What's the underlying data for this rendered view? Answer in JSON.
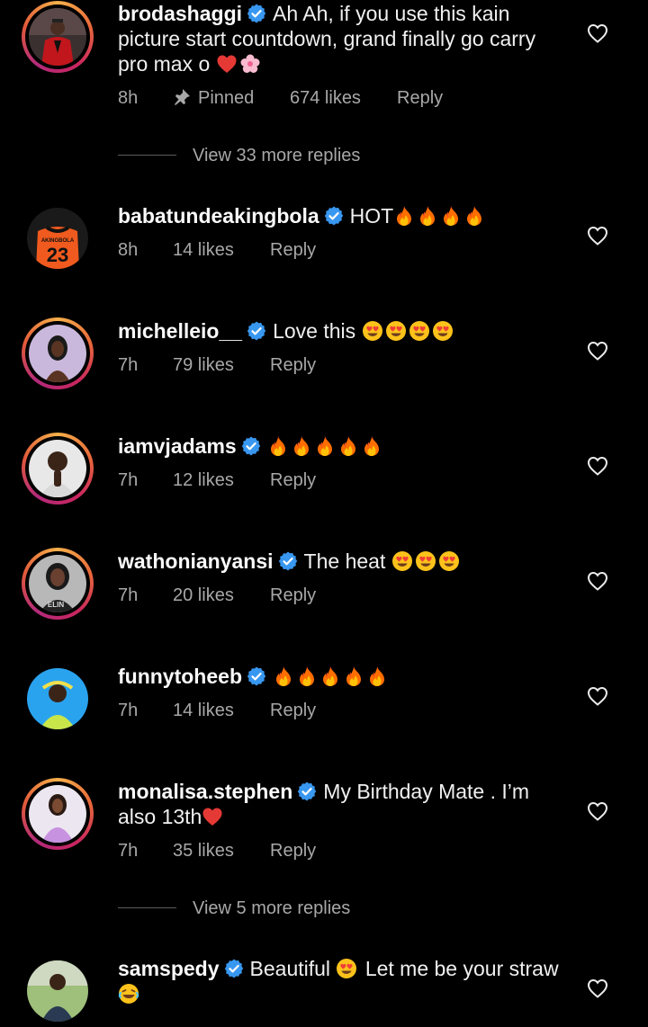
{
  "comments": [
    {
      "username": "brodashaggi",
      "text": "Ah Ah, if you use this kain picture start countdown, grand finally go carry pro max o",
      "time": "8h",
      "pinned_label": "Pinned",
      "likes": "674 likes",
      "reply": "Reply",
      "avatar": "red-suit-man"
    },
    {
      "username": "babatundeakingbola",
      "text": "HOT",
      "time": "8h",
      "likes": "14 likes",
      "reply": "Reply",
      "avatar": "jersey-23",
      "jersey_name": "AKINGBOLA",
      "jersey_number": "23"
    },
    {
      "username": "michelleio__",
      "text": "Love this",
      "time": "7h",
      "likes": "79 likes",
      "reply": "Reply",
      "avatar": "woman-lilac"
    },
    {
      "username": "iamvjadams",
      "text": "",
      "time": "7h",
      "likes": "12 likes",
      "reply": "Reply",
      "avatar": "man-praying"
    },
    {
      "username": "wathonianyansi",
      "text": "The heat",
      "time": "7h",
      "likes": "20 likes",
      "reply": "Reply",
      "avatar": "woman-elin",
      "shirt_text": "ELIN"
    },
    {
      "username": "funnytoheeb",
      "text": "",
      "time": "7h",
      "likes": "14 likes",
      "reply": "Reply",
      "avatar": "man-blue-bg"
    },
    {
      "username": "monalisa.stephen",
      "text": "My Birthday Mate . I’m also 13th",
      "time": "7h",
      "likes": "35 likes",
      "reply": "Reply",
      "avatar": "woman-purple"
    },
    {
      "username": "samspedy",
      "text_part1": "Beautiful",
      "text_part2": "Let me be your straw",
      "avatar": "man-outdoor"
    }
  ],
  "view_more": [
    {
      "label": "View 33 more replies"
    },
    {
      "label": "View 5 more replies"
    }
  ],
  "colors": {
    "background": "#000000",
    "meta_text": "#a8a8a8",
    "verified_blue": "#3897f0",
    "story_ring": [
      "#f6b04a",
      "#c9265f"
    ]
  },
  "icons": [
    "verified-badge-icon",
    "heart-outline-icon",
    "pin-icon",
    "fire-emoji",
    "heart-eyes-emoji",
    "red-heart-emoji",
    "blossom-emoji",
    "tears-of-joy-emoji"
  ]
}
